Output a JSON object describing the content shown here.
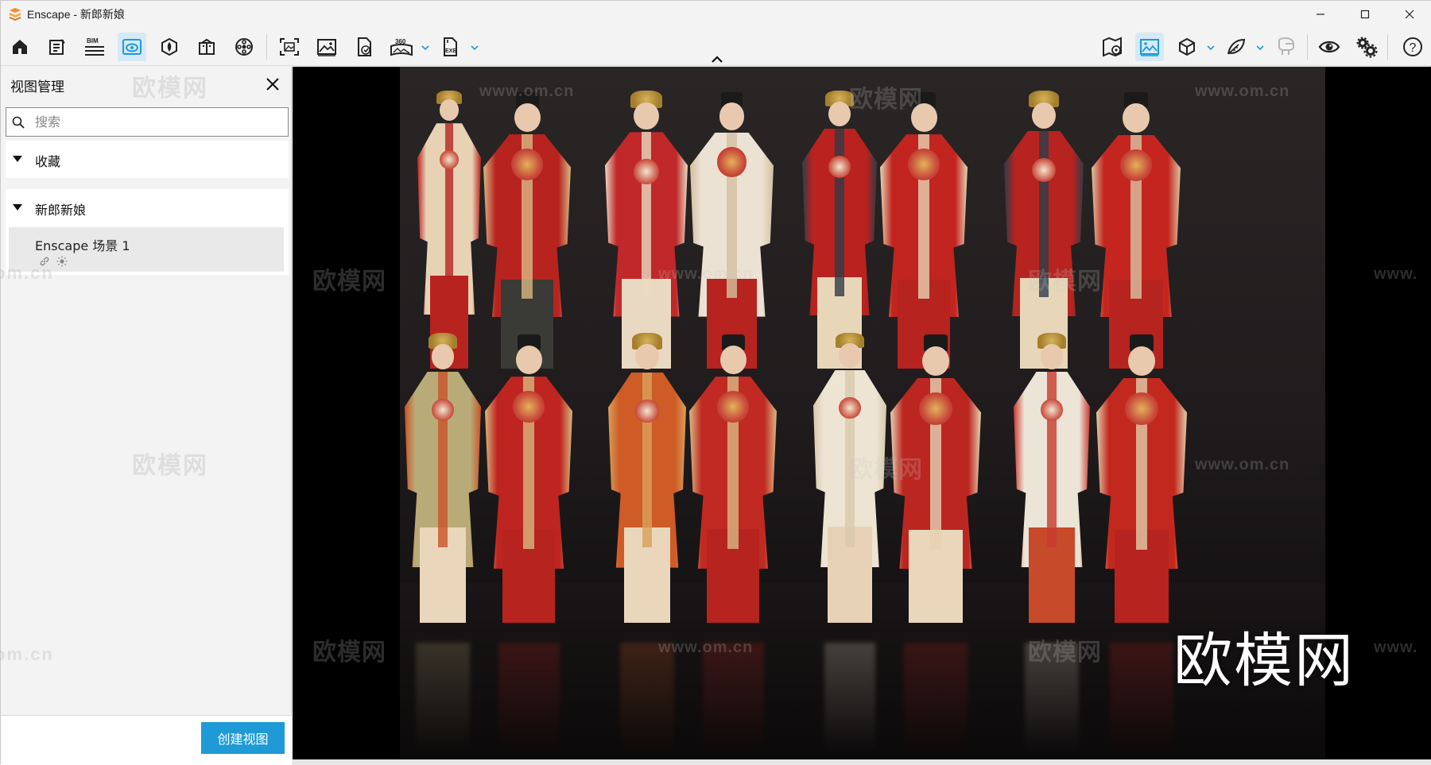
{
  "window": {
    "title": "Enscape - 新郎新娘",
    "controls": [
      "minimize",
      "maximize",
      "close"
    ]
  },
  "toolbar": {
    "left_buttons": [
      {
        "id": "home",
        "icon": "home-icon"
      },
      {
        "id": "notes",
        "icon": "notes-icon"
      },
      {
        "id": "bim",
        "icon": "bim-icon",
        "label": "BIM"
      },
      {
        "id": "views",
        "icon": "eye-view-icon",
        "active": true
      },
      {
        "id": "assets",
        "icon": "asset-library-icon"
      },
      {
        "id": "materials",
        "icon": "material-editor-icon"
      },
      {
        "id": "video",
        "icon": "video-editor-icon"
      },
      {
        "id": "screenshot",
        "icon": "screenshot-icon"
      },
      {
        "id": "image",
        "icon": "render-image-icon"
      },
      {
        "id": "batch",
        "icon": "batch-render-icon"
      },
      {
        "id": "pano",
        "icon": "panorama-360-icon",
        "label": "360"
      },
      {
        "id": "exe",
        "icon": "export-exe-icon",
        "label": "EXE"
      }
    ],
    "right_buttons": [
      {
        "id": "map",
        "icon": "map-pin-icon"
      },
      {
        "id": "atmosphere",
        "icon": "atmosphere-icon"
      },
      {
        "id": "cube",
        "icon": "view-cube-icon"
      },
      {
        "id": "leaf",
        "icon": "leaf-icon"
      },
      {
        "id": "vr",
        "icon": "vr-headset-icon"
      },
      {
        "id": "visual-settings",
        "icon": "eye-icon"
      },
      {
        "id": "settings",
        "icon": "gears-icon"
      },
      {
        "id": "help",
        "icon": "help-icon",
        "label": "?"
      }
    ]
  },
  "sidebar": {
    "title": "视图管理",
    "search_placeholder": "搜索",
    "sections": [
      {
        "label": "收藏",
        "expanded": true
      },
      {
        "label": "新郎新娘",
        "expanded": true,
        "items": [
          {
            "name": "Enscape 场景 1"
          }
        ]
      }
    ],
    "create_button": "创建视图"
  },
  "viewport": {
    "watermark_big": "欧模网",
    "watermark_url": "www.om.cn",
    "watermark_cn": "欧模网",
    "watermark_edge": "om.cn",
    "watermark_edge_right": "www."
  },
  "colors": {
    "accent": "#1e9ad6",
    "toolbar_active": "#d6e9f7",
    "robe_red": "#b7231f"
  }
}
